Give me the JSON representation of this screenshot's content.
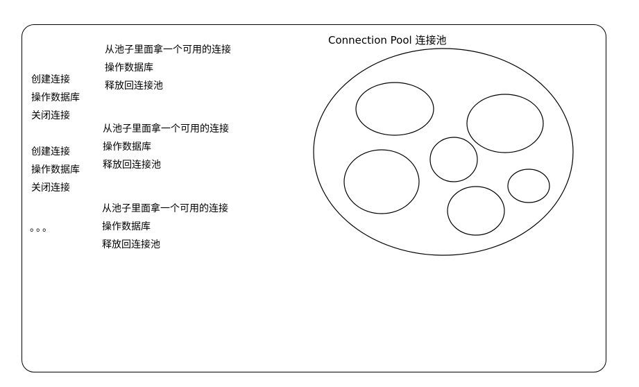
{
  "direct": {
    "group1": [
      "创建连接",
      "操作数据库",
      "关闭连接"
    ],
    "group2": [
      "创建连接",
      "操作数据库",
      "关闭连接"
    ],
    "ellipsis": "。。。"
  },
  "pooled": {
    "group1": [
      "从池子里面拿一个可用的连接",
      "操作数据库",
      "释放回连接池"
    ],
    "group2": [
      "从池子里面拿一个可用的连接",
      "操作数据库",
      "释放回连接池"
    ],
    "group3": [
      "从池子里面拿一个可用的连接",
      "操作数据库",
      "释放回连接池"
    ]
  },
  "pool": {
    "title": "Connection Pool 连接池",
    "connection_count": 6
  }
}
